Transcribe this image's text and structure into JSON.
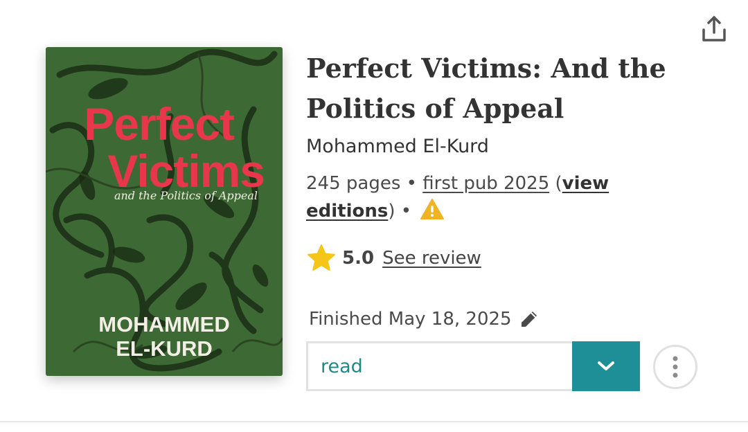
{
  "book": {
    "title": "Perfect Victims: And the Politics of Appeal",
    "author": "Mohammed El-Kurd",
    "pages": "245 pages",
    "first_pub": "first pub 2025",
    "view_editions": "view editions",
    "rating": "5.0",
    "see_review": "See review"
  },
  "cover": {
    "title_line1": "Perfect",
    "title_line2": "Victims",
    "subtitle": "and the Politics of Appeal",
    "author_line1": "MOHAMMED",
    "author_line2": "EL-KURD",
    "background": "#3d6a34",
    "title_color": "#e8364a"
  },
  "reading_status": {
    "finished_text": "Finished May 18, 2025",
    "status_value": "read",
    "accent": "#1e8f96"
  },
  "icons": {
    "share": "share-icon",
    "warning": "warning-icon",
    "star": "star-icon",
    "pencil": "pencil-icon",
    "chevron": "chevron-down-icon",
    "more": "more-vertical-icon"
  }
}
